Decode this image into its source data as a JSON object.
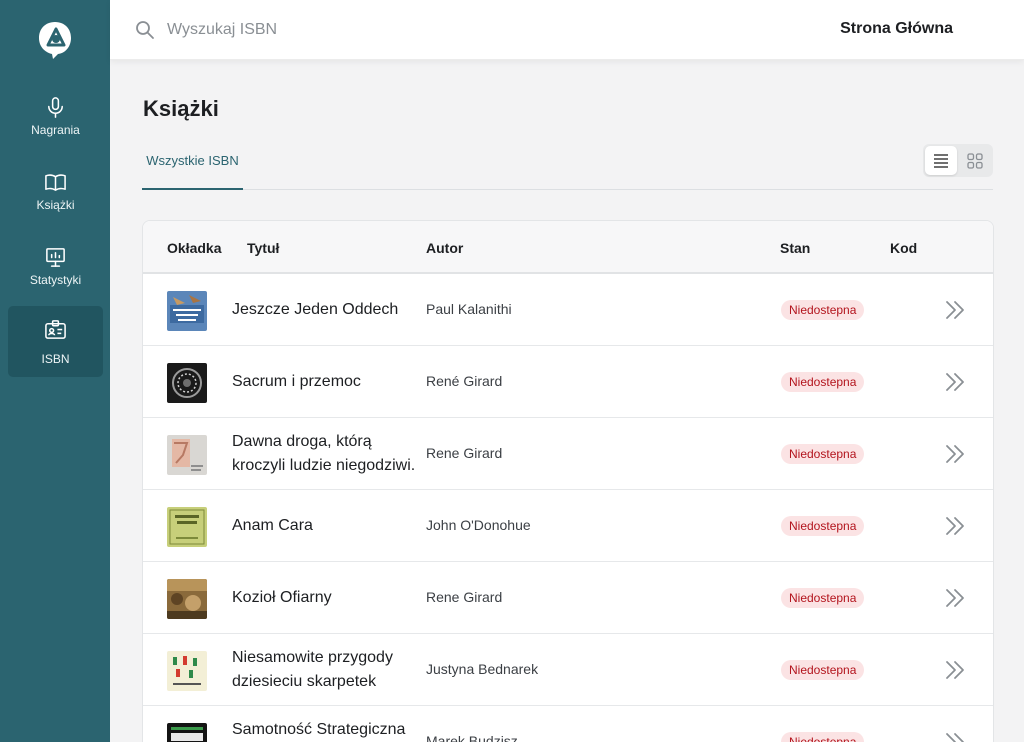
{
  "sidebar": {
    "items": [
      {
        "label": "Nagrania",
        "icon": "microphone-icon"
      },
      {
        "label": "Książki",
        "icon": "book-open-icon"
      },
      {
        "label": "Statystyki",
        "icon": "presentation-chart-icon"
      },
      {
        "label": "ISBN",
        "icon": "id-card-icon",
        "active": true
      }
    ]
  },
  "header": {
    "search_placeholder": "Wyszukaj ISBN",
    "home_label": "Strona Główna"
  },
  "main": {
    "title": "Książki",
    "tabs": [
      {
        "label": "Wszystkie ISBN",
        "active": true
      }
    ],
    "view_mode": "list"
  },
  "table": {
    "columns": [
      "Okładka",
      "Tytuł",
      "Autor",
      "Stan",
      "Kod"
    ],
    "rows": [
      {
        "title": "Jeszcze Jeden Oddech",
        "author": "Paul Kalanithi",
        "status": "Niedostepna"
      },
      {
        "title": "Sacrum i przemoc",
        "author": "René Girard",
        "status": "Niedostepna"
      },
      {
        "title": "Dawna droga, którą kroczyli ludzie niegodziwi.",
        "author": "Rene Girard",
        "status": "Niedostepna"
      },
      {
        "title": "Anam Cara",
        "author": "John O'Donohue",
        "status": "Niedostepna"
      },
      {
        "title": "Kozioł Ofiarny",
        "author": "Rene Girard",
        "status": "Niedostepna"
      },
      {
        "title": "Niesamowite przygody dziesieciu skarpetek",
        "author": "Justyna Bednarek",
        "status": "Niedostepna"
      },
      {
        "title": "Samotność Strategiczna",
        "author": "Marek Budzisz",
        "status": "Niedostepna"
      }
    ]
  },
  "colors": {
    "sidebar": "#2b6470",
    "sidebar_active": "#215560",
    "accent": "#2b6470",
    "badge_bg": "#fbe3e4",
    "badge_text": "#b3141d"
  }
}
